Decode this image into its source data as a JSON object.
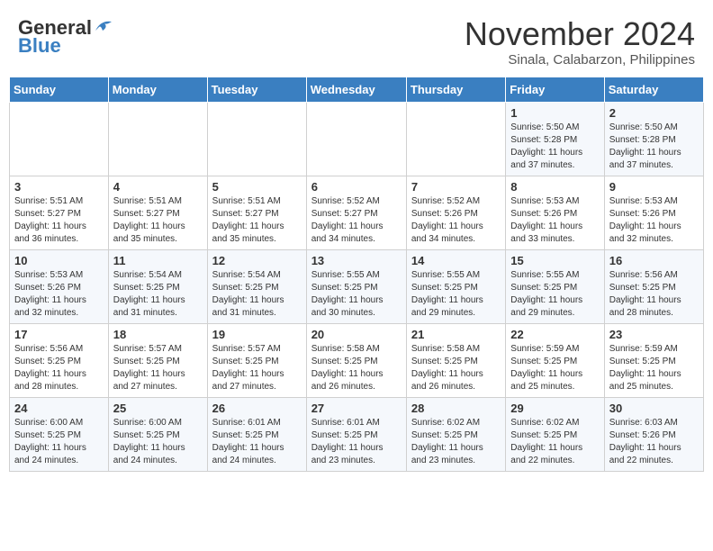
{
  "header": {
    "logo_general": "General",
    "logo_blue": "Blue",
    "month_title": "November 2024",
    "location": "Sinala, Calabarzon, Philippines"
  },
  "weekdays": [
    "Sunday",
    "Monday",
    "Tuesday",
    "Wednesday",
    "Thursday",
    "Friday",
    "Saturday"
  ],
  "weeks": [
    {
      "days": [
        {
          "num": "",
          "info": ""
        },
        {
          "num": "",
          "info": ""
        },
        {
          "num": "",
          "info": ""
        },
        {
          "num": "",
          "info": ""
        },
        {
          "num": "",
          "info": ""
        },
        {
          "num": "1",
          "info": "Sunrise: 5:50 AM\nSunset: 5:28 PM\nDaylight: 11 hours\nand 37 minutes."
        },
        {
          "num": "2",
          "info": "Sunrise: 5:50 AM\nSunset: 5:28 PM\nDaylight: 11 hours\nand 37 minutes."
        }
      ]
    },
    {
      "days": [
        {
          "num": "3",
          "info": "Sunrise: 5:51 AM\nSunset: 5:27 PM\nDaylight: 11 hours\nand 36 minutes."
        },
        {
          "num": "4",
          "info": "Sunrise: 5:51 AM\nSunset: 5:27 PM\nDaylight: 11 hours\nand 35 minutes."
        },
        {
          "num": "5",
          "info": "Sunrise: 5:51 AM\nSunset: 5:27 PM\nDaylight: 11 hours\nand 35 minutes."
        },
        {
          "num": "6",
          "info": "Sunrise: 5:52 AM\nSunset: 5:27 PM\nDaylight: 11 hours\nand 34 minutes."
        },
        {
          "num": "7",
          "info": "Sunrise: 5:52 AM\nSunset: 5:26 PM\nDaylight: 11 hours\nand 34 minutes."
        },
        {
          "num": "8",
          "info": "Sunrise: 5:53 AM\nSunset: 5:26 PM\nDaylight: 11 hours\nand 33 minutes."
        },
        {
          "num": "9",
          "info": "Sunrise: 5:53 AM\nSunset: 5:26 PM\nDaylight: 11 hours\nand 32 minutes."
        }
      ]
    },
    {
      "days": [
        {
          "num": "10",
          "info": "Sunrise: 5:53 AM\nSunset: 5:26 PM\nDaylight: 11 hours\nand 32 minutes."
        },
        {
          "num": "11",
          "info": "Sunrise: 5:54 AM\nSunset: 5:25 PM\nDaylight: 11 hours\nand 31 minutes."
        },
        {
          "num": "12",
          "info": "Sunrise: 5:54 AM\nSunset: 5:25 PM\nDaylight: 11 hours\nand 31 minutes."
        },
        {
          "num": "13",
          "info": "Sunrise: 5:55 AM\nSunset: 5:25 PM\nDaylight: 11 hours\nand 30 minutes."
        },
        {
          "num": "14",
          "info": "Sunrise: 5:55 AM\nSunset: 5:25 PM\nDaylight: 11 hours\nand 29 minutes."
        },
        {
          "num": "15",
          "info": "Sunrise: 5:55 AM\nSunset: 5:25 PM\nDaylight: 11 hours\nand 29 minutes."
        },
        {
          "num": "16",
          "info": "Sunrise: 5:56 AM\nSunset: 5:25 PM\nDaylight: 11 hours\nand 28 minutes."
        }
      ]
    },
    {
      "days": [
        {
          "num": "17",
          "info": "Sunrise: 5:56 AM\nSunset: 5:25 PM\nDaylight: 11 hours\nand 28 minutes."
        },
        {
          "num": "18",
          "info": "Sunrise: 5:57 AM\nSunset: 5:25 PM\nDaylight: 11 hours\nand 27 minutes."
        },
        {
          "num": "19",
          "info": "Sunrise: 5:57 AM\nSunset: 5:25 PM\nDaylight: 11 hours\nand 27 minutes."
        },
        {
          "num": "20",
          "info": "Sunrise: 5:58 AM\nSunset: 5:25 PM\nDaylight: 11 hours\nand 26 minutes."
        },
        {
          "num": "21",
          "info": "Sunrise: 5:58 AM\nSunset: 5:25 PM\nDaylight: 11 hours\nand 26 minutes."
        },
        {
          "num": "22",
          "info": "Sunrise: 5:59 AM\nSunset: 5:25 PM\nDaylight: 11 hours\nand 25 minutes."
        },
        {
          "num": "23",
          "info": "Sunrise: 5:59 AM\nSunset: 5:25 PM\nDaylight: 11 hours\nand 25 minutes."
        }
      ]
    },
    {
      "days": [
        {
          "num": "24",
          "info": "Sunrise: 6:00 AM\nSunset: 5:25 PM\nDaylight: 11 hours\nand 24 minutes."
        },
        {
          "num": "25",
          "info": "Sunrise: 6:00 AM\nSunset: 5:25 PM\nDaylight: 11 hours\nand 24 minutes."
        },
        {
          "num": "26",
          "info": "Sunrise: 6:01 AM\nSunset: 5:25 PM\nDaylight: 11 hours\nand 24 minutes."
        },
        {
          "num": "27",
          "info": "Sunrise: 6:01 AM\nSunset: 5:25 PM\nDaylight: 11 hours\nand 23 minutes."
        },
        {
          "num": "28",
          "info": "Sunrise: 6:02 AM\nSunset: 5:25 PM\nDaylight: 11 hours\nand 23 minutes."
        },
        {
          "num": "29",
          "info": "Sunrise: 6:02 AM\nSunset: 5:25 PM\nDaylight: 11 hours\nand 22 minutes."
        },
        {
          "num": "30",
          "info": "Sunrise: 6:03 AM\nSunset: 5:26 PM\nDaylight: 11 hours\nand 22 minutes."
        }
      ]
    }
  ]
}
